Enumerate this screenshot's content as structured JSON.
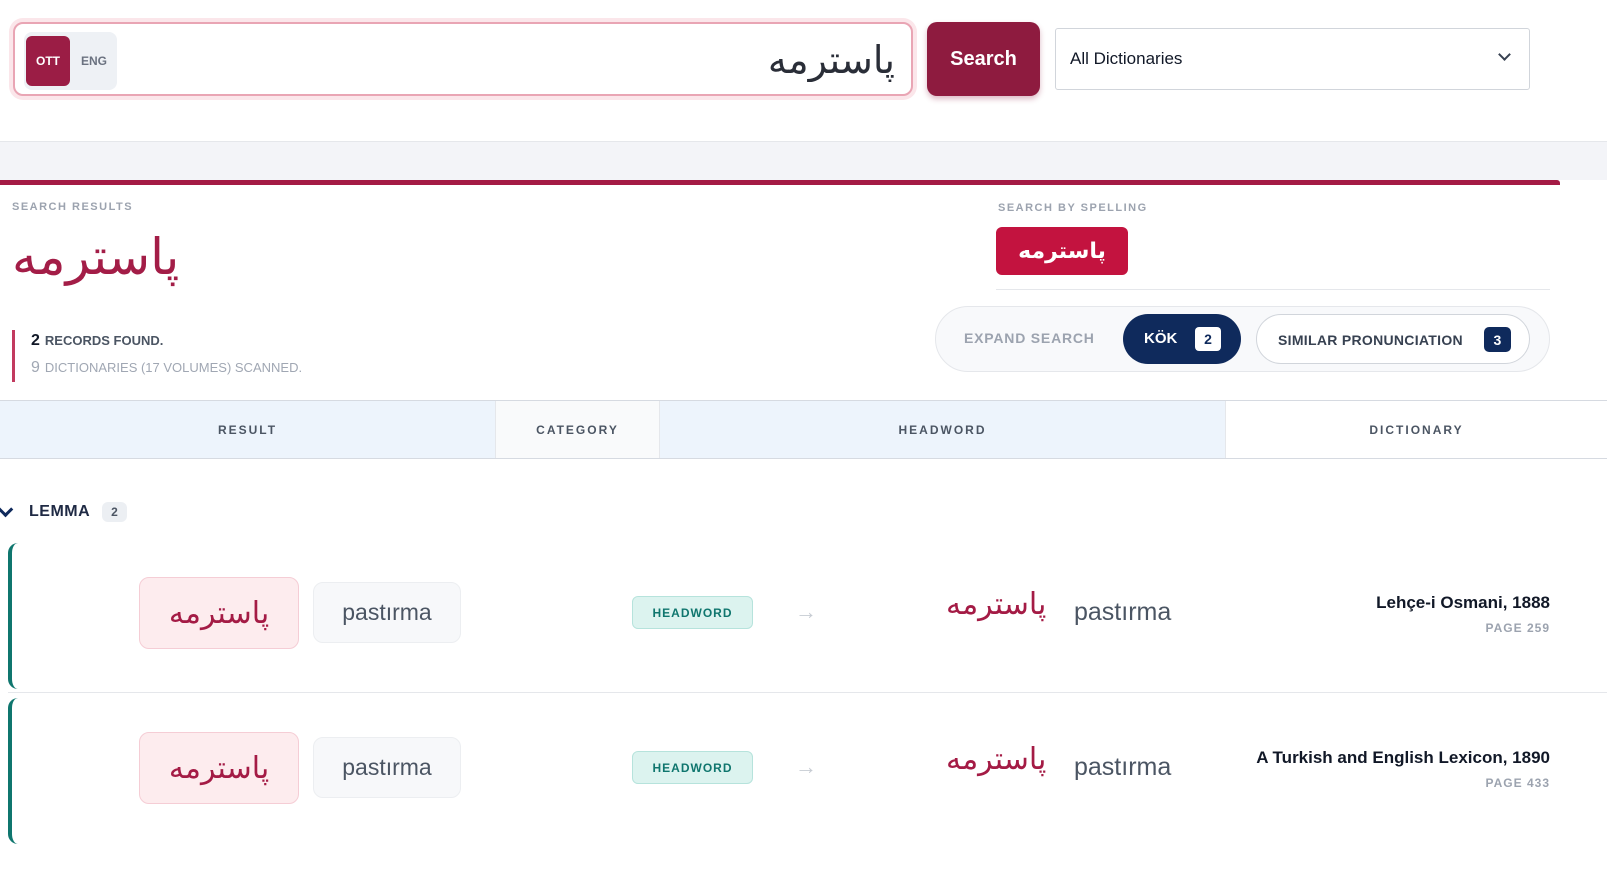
{
  "search": {
    "lang_ott": "OTT",
    "lang_eng": "ENG",
    "query": "پاسترمه",
    "button_label": "Search",
    "dictionary_selected": "All Dictionaries"
  },
  "results": {
    "section_label": "SEARCH RESULTS",
    "query_display": "پاسترمه",
    "records_count": "2",
    "records_label": "RECORDS FOUND.",
    "dictionaries_count": "9",
    "dictionaries_label": "DICTIONARIES (17 VOLUMES) SCANNED."
  },
  "spelling": {
    "label": "SEARCH BY SPELLING",
    "value": "پاسترمه"
  },
  "expand": {
    "label": "EXPAND SEARCH",
    "kok_label": "KÖK",
    "kok_count": "2",
    "similar_label": "SIMILAR PRONUNCIATION",
    "similar_count": "3"
  },
  "table": {
    "columns": [
      "RESULT",
      "CATEGORY",
      "HEADWORD",
      "DICTIONARY"
    ]
  },
  "groups": [
    {
      "label": "LEMMA",
      "count": "2",
      "rows": [
        {
          "ott": "پاسترمه",
          "latin": "pastırma",
          "category": "HEADWORD",
          "headword_ott": "پاسترمه",
          "headword_latin": "pastırma",
          "dictionary": "Lehçe-i Osmani, 1888",
          "page": "PAGE 259"
        },
        {
          "ott": "پاسترمه",
          "latin": "pastırma",
          "category": "HEADWORD",
          "headword_ott": "پاسترمه",
          "headword_latin": "pastırma",
          "dictionary": "A Turkish and English Lexicon, 1890",
          "page": "PAGE 433"
        }
      ]
    }
  ],
  "colors": {
    "brand": "#8e1b3f",
    "accent": "#a41b45",
    "navy": "#0f2a5c",
    "teal": "#0f766e"
  }
}
